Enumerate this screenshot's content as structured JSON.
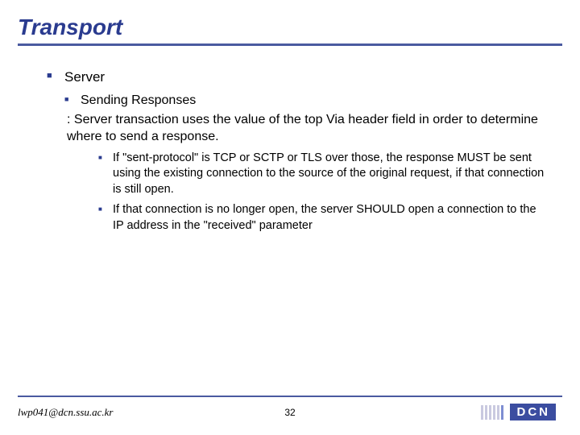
{
  "title": "Transport",
  "server": {
    "label": "Server",
    "sending": {
      "label": "Sending Responses",
      "desc": ": Server transaction uses the value of the top Via header field in order to determine where to send a response.",
      "points": [
        "If \"sent-protocol\" is TCP or SCTP or TLS over those, the response MUST be sent using the existing connection to the source of the original request, if that connection is still open.",
        "If that connection is no longer open, the server SHOULD open a connection to the IP address in the \"received\" parameter"
      ]
    }
  },
  "footer": {
    "email": "lwp041@dcn.ssu.ac.kr",
    "page": "32",
    "logo": "DCN"
  }
}
